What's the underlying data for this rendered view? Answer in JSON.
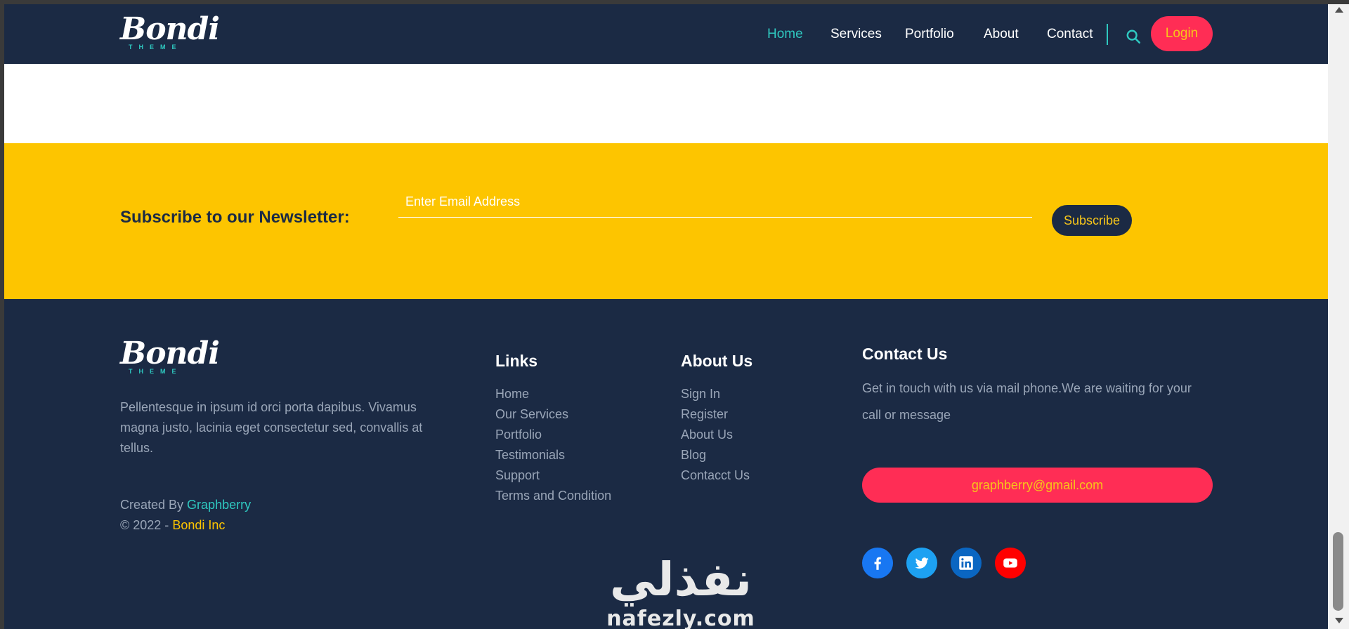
{
  "header": {
    "logo_word": "Bondi",
    "logo_sub": "THEME",
    "nav": [
      "Home",
      "Services",
      "Portfolio",
      "About",
      "Contact"
    ],
    "login_label": "Login"
  },
  "newsletter": {
    "title": "Subscribe to our Newsletter:",
    "placeholder": "Enter Email Address",
    "button_label": "Subscribe"
  },
  "footer": {
    "logo_word": "Bondi",
    "logo_sub": "THEME",
    "description": "Pellentesque in ipsum id orci porta dapibus. Vivamus magna justo, lacinia eget consectetur sed, convallis at tellus.",
    "created_prefix": "Created By ",
    "created_by": "Graphberry",
    "copyright_prefix": "© 2022 - ",
    "company": "Bondi Inc",
    "links_title": "Links",
    "links": [
      "Home",
      "Our Services",
      "Portfolio",
      "Testimonials",
      "Support",
      "Terms and Condition"
    ],
    "about_title": "About Us",
    "about_links": [
      "Sign In",
      "Register",
      "About Us",
      "Blog",
      "Contacct Us"
    ],
    "contact_title": "Contact Us",
    "contact_text": "Get in touch with us via mail phone.We are waiting for your call or message",
    "email": "graphberry@gmail.com",
    "social_icons": [
      "facebook-icon",
      "twitter-icon",
      "linkedin-icon",
      "youtube-icon"
    ]
  },
  "watermark": {
    "arabic": "نفذلي",
    "latin": "nafezly.com"
  },
  "colors": {
    "navy": "#1b2a44",
    "teal": "#2fc8c0",
    "yellow": "#fdc500",
    "pink": "#ff2d55",
    "muted_text": "#9aa6b8"
  }
}
